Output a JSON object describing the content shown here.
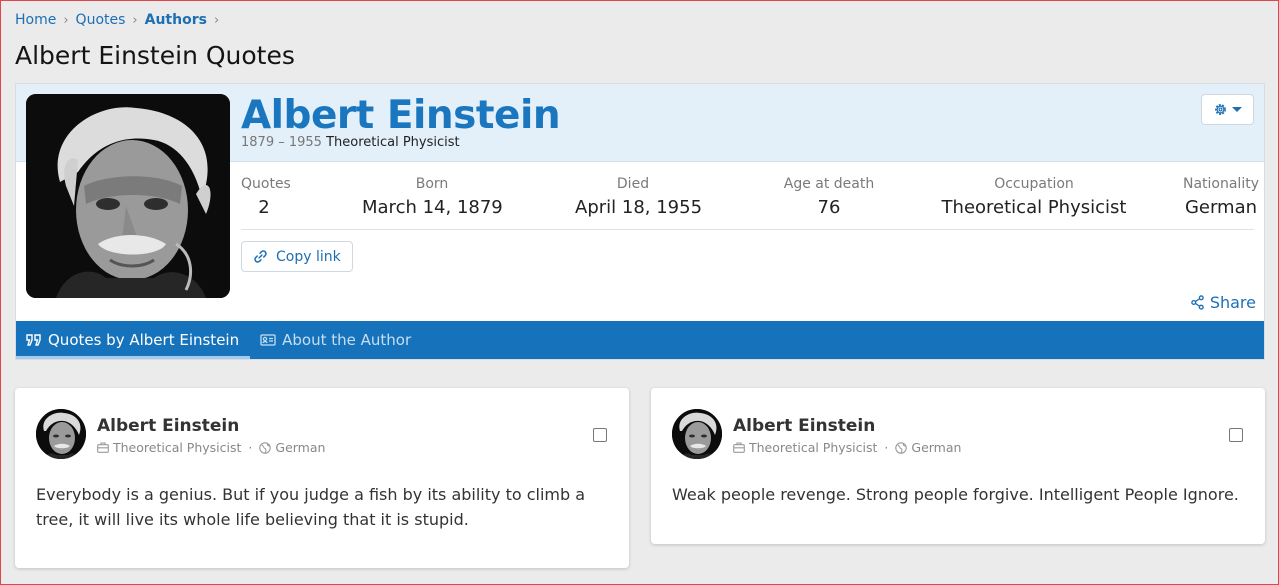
{
  "breadcrumb": [
    "Home",
    "Quotes",
    "Authors"
  ],
  "page_title": "Albert Einstein Quotes",
  "author": {
    "name": "Albert Einstein",
    "years": "1879 – 1955",
    "occupation": "Theoretical Physicist",
    "stats": [
      {
        "label": "Quotes",
        "value": "2"
      },
      {
        "label": "Born",
        "value": "March 14, 1879"
      },
      {
        "label": "Died",
        "value": "April 18, 1955"
      },
      {
        "label": "Age at death",
        "value": "76"
      },
      {
        "label": "Occupation",
        "value": "Theoretical Physicist"
      },
      {
        "label": "Nationality",
        "value": "German"
      }
    ],
    "copy_link_label": "Copy link",
    "share_label": "Share"
  },
  "tabs": [
    {
      "label": "Quotes by Albert Einstein",
      "active": true
    },
    {
      "label": "About the Author",
      "active": false
    }
  ],
  "quotes": [
    {
      "author": "Albert Einstein",
      "occupation": "Theoretical Physicist",
      "nationality": "German",
      "text": "Everybody is a genius. But if you judge a fish by its ability to climb a tree, it will live its whole life believing that it is stupid."
    },
    {
      "author": "Albert Einstein",
      "occupation": "Theoretical Physicist",
      "nationality": "German",
      "text": "Weak people revenge. Strong people forgive. Intelligent People Ignore."
    }
  ],
  "colors": {
    "accent": "#1976bf",
    "tab_bar": "#1673bb",
    "header_bg": "#e3eff9",
    "page_bg": "#ebebeb"
  },
  "icons": [
    "chevron-right-icon",
    "gear-icon",
    "chevron-down-icon",
    "link-icon",
    "share-icon",
    "quote-icon",
    "id-card-icon",
    "briefcase-icon",
    "globe-icon"
  ]
}
